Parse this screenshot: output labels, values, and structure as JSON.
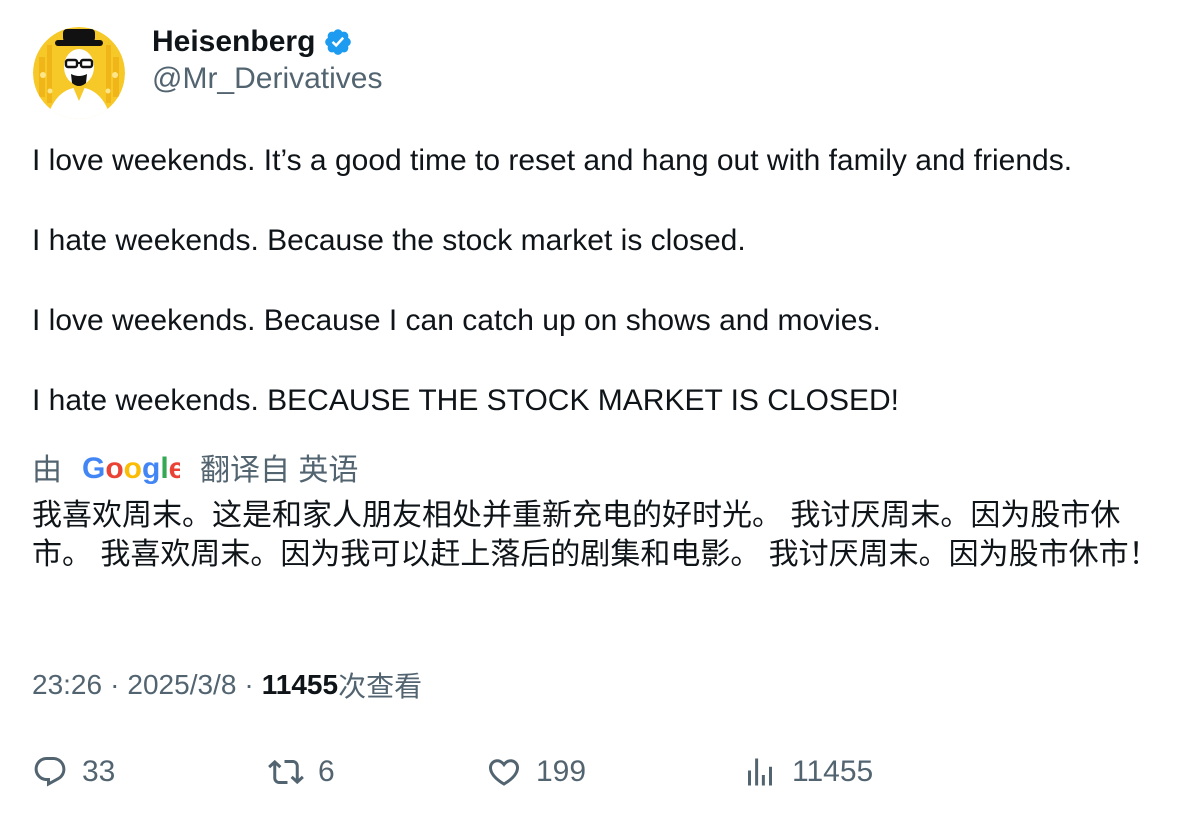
{
  "author": {
    "display_name": "Heisenberg",
    "handle": "@Mr_Derivatives",
    "avatar_icon": "heisenberg-portrait-icon",
    "verified_icon": "verified-badge-icon",
    "verified_color": "#1d9bf0"
  },
  "tweet": {
    "lines": [
      "I love weekends. It’s a good time to reset and hang out with family and friends.",
      "I hate weekends. Because the stock market is closed.",
      "I love weekends. Because I can catch up on shows and movies.",
      "I hate weekends. BECAUSE THE STOCK MARKET IS CLOSED!"
    ]
  },
  "translation": {
    "prefix": "由",
    "provider": "Google",
    "suffix": "翻译自 英语",
    "text": "我喜欢周末。这是和家人朋友相处并重新充电的好时光。 我讨厌周末。因为股市休市。 我喜欢周末。因为我可以赶上落后的剧集和电影。 我讨厌周末。因为股市休市！"
  },
  "meta": {
    "time": "23:26",
    "separator": "·",
    "date": "2025/3/8",
    "views_count": "11455",
    "views_label": "次查看"
  },
  "actions": {
    "reply": {
      "icon": "reply-icon",
      "count": "33"
    },
    "retweet": {
      "icon": "retweet-icon",
      "count": "6"
    },
    "like": {
      "icon": "heart-icon",
      "count": "199"
    },
    "views": {
      "icon": "analytics-icon",
      "count": "11455"
    }
  },
  "colors": {
    "text_primary": "#0f1419",
    "text_secondary": "#536471",
    "google_blue": "#4285F4",
    "google_red": "#EA4335",
    "google_yellow": "#FBBC05",
    "google_green": "#34A853"
  }
}
